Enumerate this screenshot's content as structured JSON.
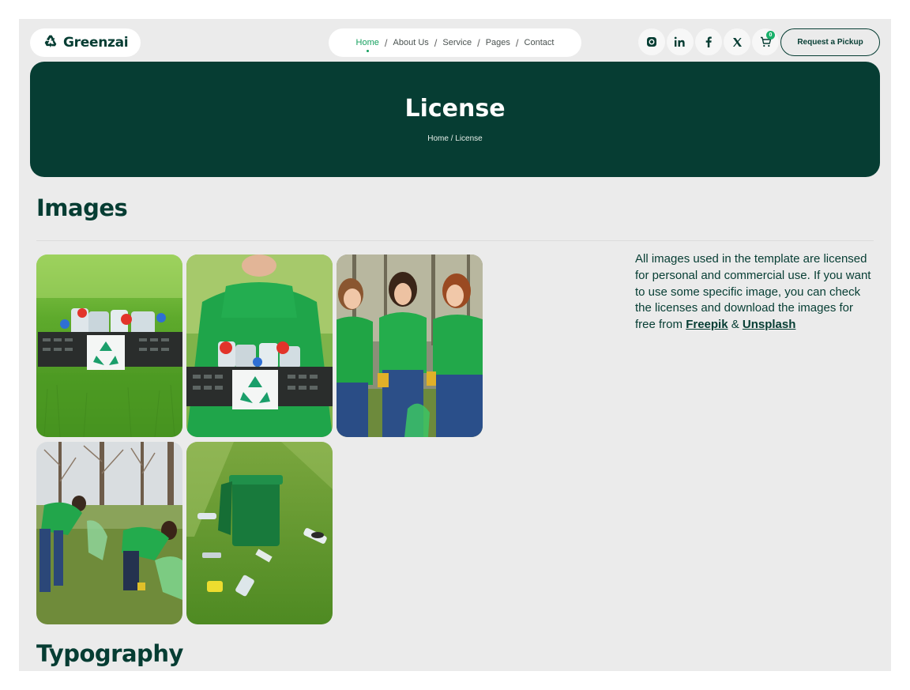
{
  "brand": {
    "name": "Greenzai",
    "icon": "recycle-icon",
    "color": "#063d33",
    "accent": "#14a05e"
  },
  "nav": {
    "items": [
      {
        "label": "Home",
        "active": true
      },
      {
        "label": "About Us"
      },
      {
        "label": "Service"
      },
      {
        "label": "Pages"
      },
      {
        "label": "Contact"
      }
    ],
    "separator": "/"
  },
  "socials": [
    {
      "icon": "instagram-icon"
    },
    {
      "icon": "linkedin-icon"
    },
    {
      "icon": "facebook-icon"
    },
    {
      "icon": "x-twitter-icon"
    },
    {
      "icon": "cart-icon",
      "badge": "0"
    }
  ],
  "cta": {
    "label": "Request a Pickup"
  },
  "hero": {
    "title": "License",
    "breadcrumb": "Home / License"
  },
  "images_section": {
    "heading": "Images",
    "photos": [
      {
        "subject": "recycling crate with plastic bottles on grass"
      },
      {
        "subject": "volunteer holding recycling crate"
      },
      {
        "subject": "three volunteers in green shirts"
      },
      {
        "subject": "volunteers collecting litter in park"
      },
      {
        "subject": "green bin with scattered litter on grass"
      }
    ],
    "description_text": "All images used in the template are licensed for personal and commercial use. If you want to use some specific image, you can check the licenses and download the images for free from",
    "link_freepik": "Freepik",
    "and_text": " & ",
    "link_unsplash": "Unsplash"
  },
  "typography_section": {
    "heading": "Typography"
  }
}
